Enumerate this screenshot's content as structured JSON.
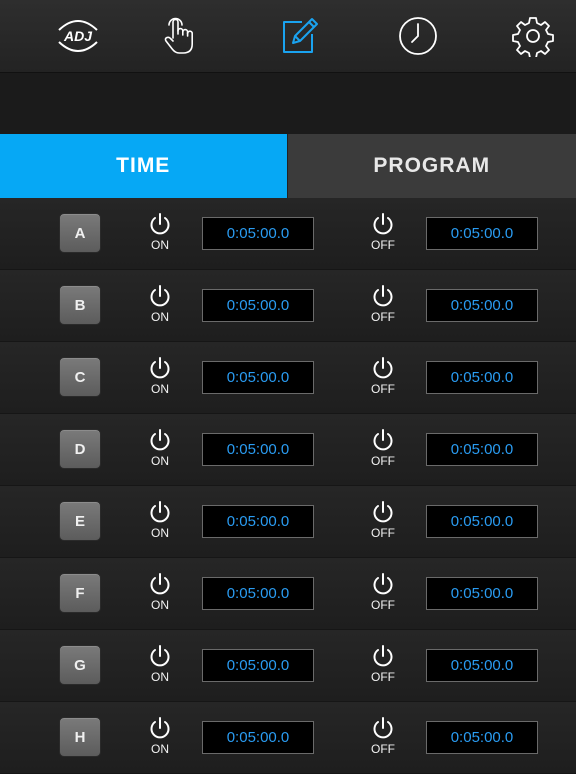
{
  "colors": {
    "accent": "#06a8f5",
    "time_text": "#2a9cf2",
    "background": "#202020"
  },
  "nav": {
    "logo_text": "ADJ",
    "icons": [
      "touch-hand-icon",
      "edit-pencil-icon",
      "clock-icon",
      "gear-icon"
    ],
    "active": "edit-pencil-icon"
  },
  "tabs": {
    "time": "TIME",
    "program": "PROGRAM",
    "active": "time"
  },
  "rows": [
    {
      "letter": "A",
      "on_label": "ON",
      "on_time": "0:05:00.0",
      "off_label": "OFF",
      "off_time": "0:05:00.0"
    },
    {
      "letter": "B",
      "on_label": "ON",
      "on_time": "0:05:00.0",
      "off_label": "OFF",
      "off_time": "0:05:00.0"
    },
    {
      "letter": "C",
      "on_label": "ON",
      "on_time": "0:05:00.0",
      "off_label": "OFF",
      "off_time": "0:05:00.0"
    },
    {
      "letter": "D",
      "on_label": "ON",
      "on_time": "0:05:00.0",
      "off_label": "OFF",
      "off_time": "0:05:00.0"
    },
    {
      "letter": "E",
      "on_label": "ON",
      "on_time": "0:05:00.0",
      "off_label": "OFF",
      "off_time": "0:05:00.0"
    },
    {
      "letter": "F",
      "on_label": "ON",
      "on_time": "0:05:00.0",
      "off_label": "OFF",
      "off_time": "0:05:00.0"
    },
    {
      "letter": "G",
      "on_label": "ON",
      "on_time": "0:05:00.0",
      "off_label": "OFF",
      "off_time": "0:05:00.0"
    },
    {
      "letter": "H",
      "on_label": "ON",
      "on_time": "0:05:00.0",
      "off_label": "OFF",
      "off_time": "0:05:00.0"
    }
  ]
}
